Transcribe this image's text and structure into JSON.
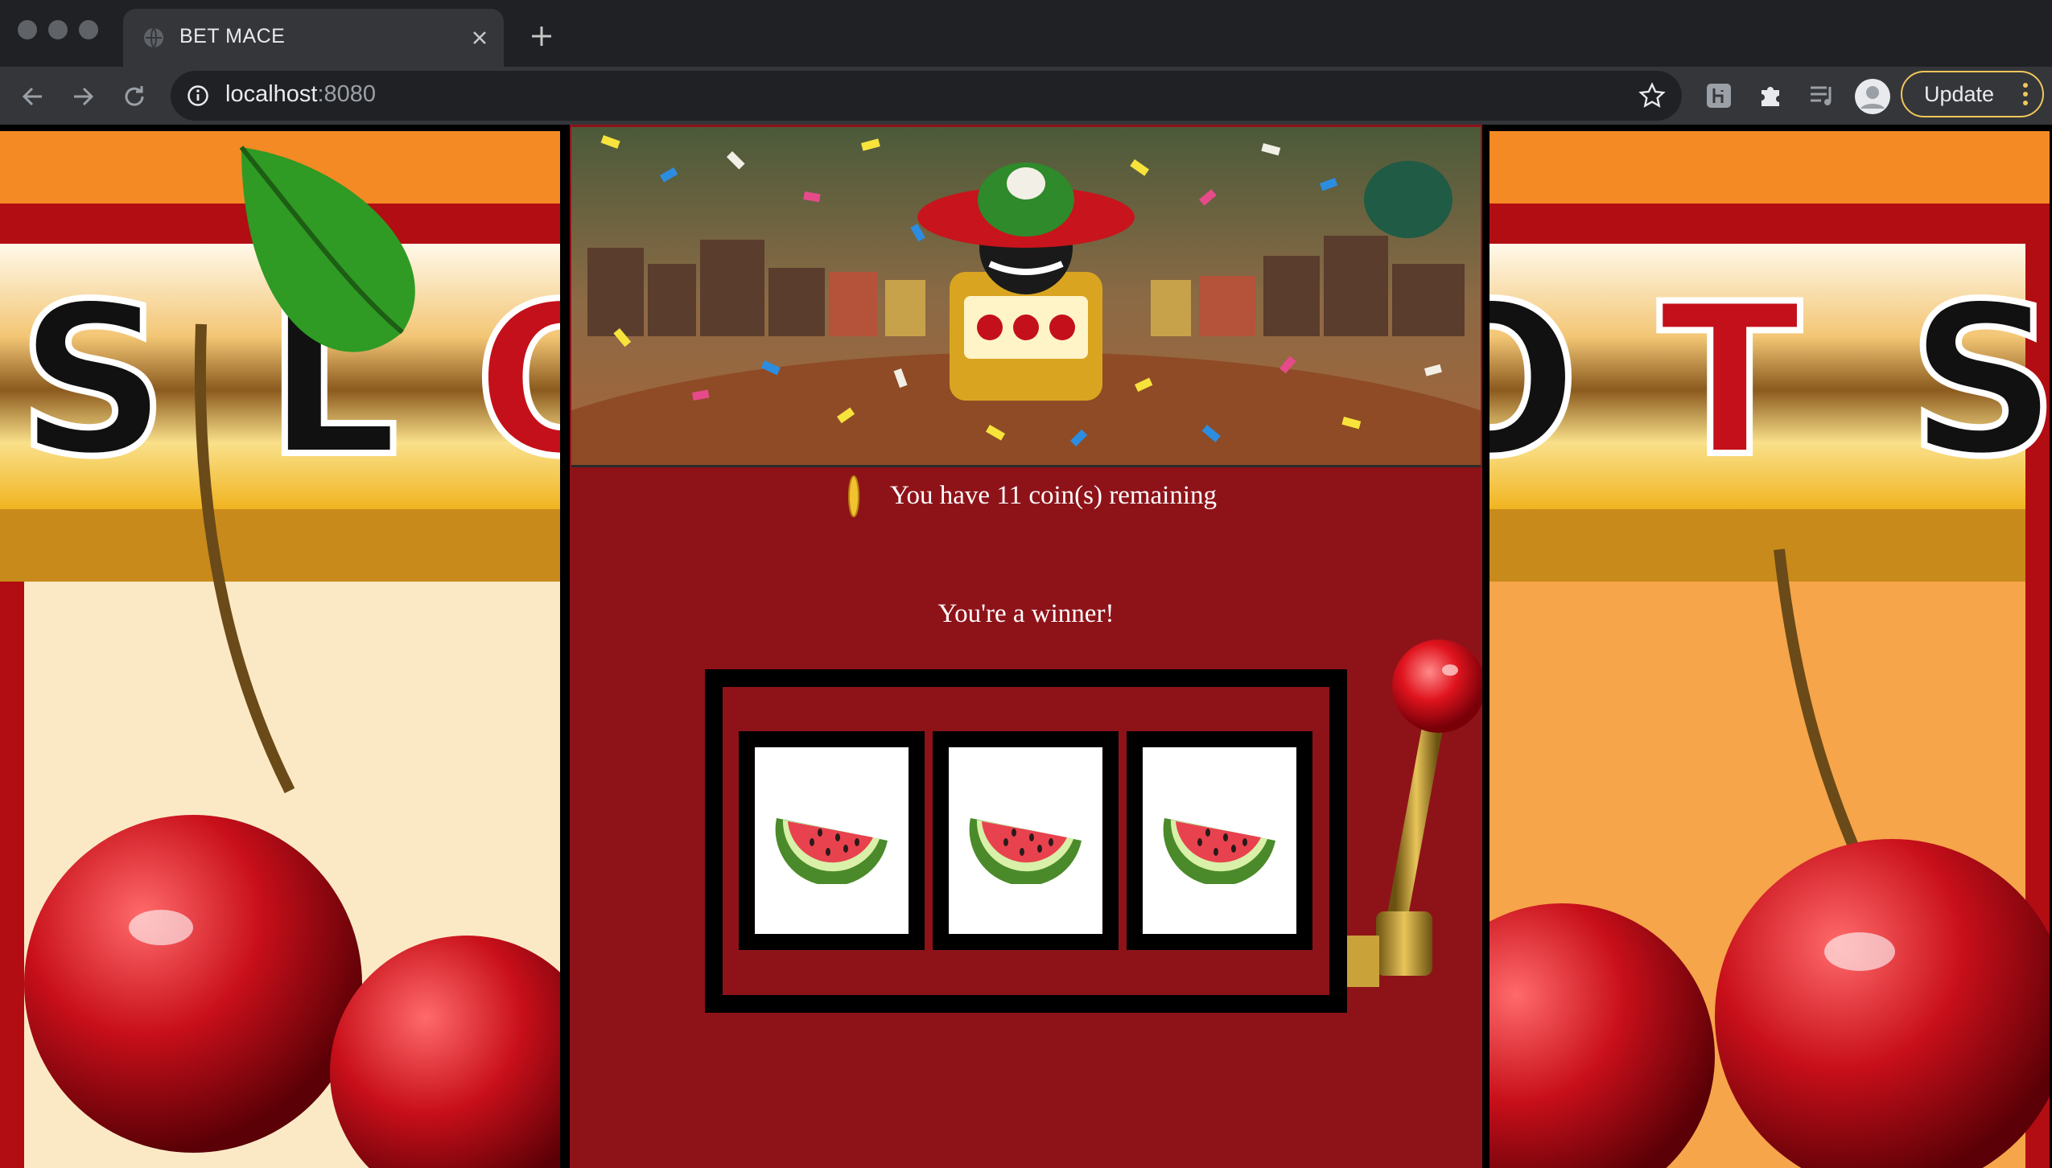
{
  "browser": {
    "tab_title": "BET MACE",
    "url_host": "localhost",
    "url_port": ":8080",
    "update_label": "Update"
  },
  "icons": {
    "tab_favicon": "globe-icon",
    "tab_close": "close-icon",
    "new_tab": "plus-icon",
    "back": "arrow-left-icon",
    "forward": "arrow-right-icon",
    "reload": "reload-icon",
    "site_info": "info-icon",
    "bookmark": "star-icon",
    "extensions": [
      "h-extension-icon",
      "puzzle-icon",
      "media-queue-icon"
    ],
    "profile": "avatar-icon",
    "menu": "more-vert-icon"
  },
  "game": {
    "coins_text": "You have 11 coin(s) remaining",
    "status_text": "You're a winner!",
    "reels": [
      "watermelon",
      "watermelon",
      "watermelon"
    ]
  },
  "colors": {
    "game_bg": "#8e1319",
    "frame": "#000000",
    "update_border": "#f0c75a"
  }
}
